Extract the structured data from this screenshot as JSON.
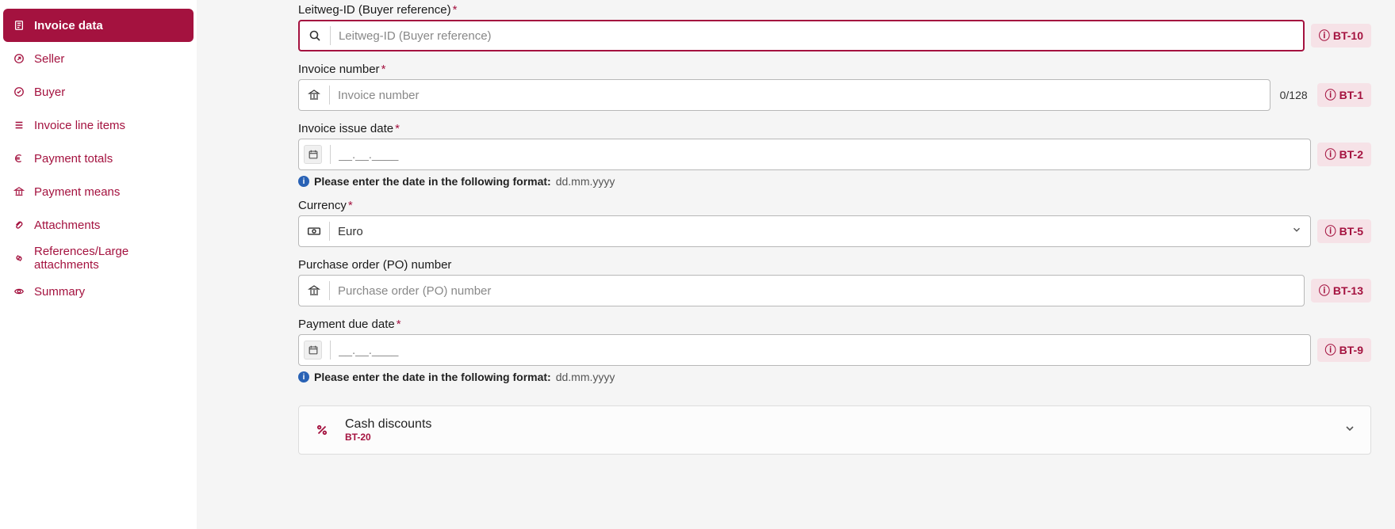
{
  "sidebar": {
    "items": [
      {
        "label": "Invoice data",
        "icon": "document"
      },
      {
        "label": "Seller",
        "icon": "arrow-out"
      },
      {
        "label": "Buyer",
        "icon": "check-circle"
      },
      {
        "label": "Invoice line items",
        "icon": "list"
      },
      {
        "label": "Payment totals",
        "icon": "euro"
      },
      {
        "label": "Payment means",
        "icon": "bank"
      },
      {
        "label": "Attachments",
        "icon": "paperclip"
      },
      {
        "label": "References/Large attachments",
        "icon": "link"
      },
      {
        "label": "Summary",
        "icon": "eye"
      }
    ]
  },
  "fields": {
    "leitweg": {
      "label": "Leitweg-ID (Buyer reference)",
      "placeholder": "Leitweg-ID (Buyer reference)",
      "bt": "BT-10",
      "required": true
    },
    "invoice_number": {
      "label": "Invoice number",
      "placeholder": "Invoice number",
      "counter": "0/128",
      "bt": "BT-1",
      "required": true
    },
    "issue_date": {
      "label": "Invoice issue date",
      "placeholder": "__.__.____",
      "bt": "BT-2",
      "hint": "Please enter the date in the following format:",
      "hint_example": "dd.mm.yyyy",
      "required": true
    },
    "currency": {
      "label": "Currency",
      "value": "Euro",
      "bt": "BT-5",
      "required": true
    },
    "po_number": {
      "label": "Purchase order (PO) number",
      "placeholder": "Purchase order (PO) number",
      "bt": "BT-13",
      "required": false
    },
    "due_date": {
      "label": "Payment due date",
      "placeholder": "__.__.____",
      "bt": "BT-9",
      "hint": "Please enter the date in the following format:",
      "hint_example": "dd.mm.yyyy",
      "required": true
    }
  },
  "cash_discounts": {
    "title": "Cash discounts",
    "bt": "BT-20"
  }
}
